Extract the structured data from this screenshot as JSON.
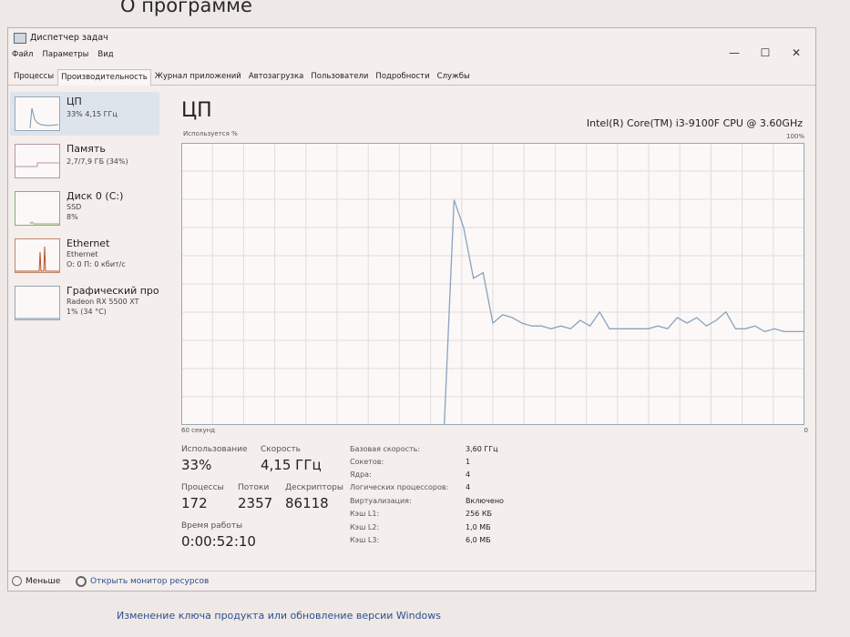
{
  "background": {
    "heading": "О программе",
    "link": "Изменение ключа продукта или обновление версии Windows"
  },
  "window": {
    "title": "Диспетчер задач",
    "controls": {
      "minimize": "—",
      "maximize": "☐",
      "close": "✕"
    }
  },
  "menu": [
    "Файл",
    "Параметры",
    "Вид"
  ],
  "tabs": [
    "Процессы",
    "Производительность",
    "Журнал приложений",
    "Автозагрузка",
    "Пользователи",
    "Подробности",
    "Службы"
  ],
  "active_tab": "Производительность",
  "sidebar": [
    {
      "name": "ЦП",
      "lines": [
        "33% 4,15 ГГц"
      ]
    },
    {
      "name": "Память",
      "lines": [
        "2,7/7,9 ГБ (34%)"
      ]
    },
    {
      "name": "Диск 0 (C:)",
      "lines": [
        "SSD",
        "8%"
      ]
    },
    {
      "name": "Ethernet",
      "lines": [
        "Ethernet",
        "О: 0 П: 0 кбит/с"
      ]
    },
    {
      "name": "Графический про",
      "lines": [
        "Radeon RX 5500 XT",
        "1% (34 °C)"
      ]
    }
  ],
  "main": {
    "title": "ЦП",
    "model": "Intel(R) Core(TM) i3-9100F CPU @ 3.60GHz",
    "graph_label": "Используется %",
    "graph_max": "100%",
    "graph_time": "60 секунд",
    "graph_min": "0"
  },
  "stats": {
    "usage_label": "Использование",
    "usage_value": "33%",
    "speed_label": "Скорость",
    "speed_value": "4,15 ГГц",
    "processes_label": "Процессы",
    "processes_value": "172",
    "threads_label": "Потоки",
    "threads_value": "2357",
    "handles_label": "Дескрипторы",
    "handles_value": "86118",
    "uptime_label": "Время работы",
    "uptime_value": "0:00:52:10"
  },
  "specs": [
    {
      "label": "Базовая скорость:",
      "value": "3,60 ГГц"
    },
    {
      "label": "Сокетов:",
      "value": "1"
    },
    {
      "label": "Ядра:",
      "value": "4"
    },
    {
      "label": "Логических процессоров:",
      "value": "4"
    },
    {
      "label": "Виртуализация:",
      "value": "Включено"
    },
    {
      "label": "Кэш L1:",
      "value": "256 КБ"
    },
    {
      "label": "Кэш L2:",
      "value": "1,0 МБ"
    },
    {
      "label": "Кэш L3:",
      "value": "6,0 МБ"
    }
  ],
  "footer": {
    "less": "Меньше",
    "resmon": "Открыть монитор ресурсов"
  },
  "chart_data": {
    "type": "line",
    "x": [
      0,
      1,
      2,
      3,
      4,
      5,
      6,
      7,
      8,
      9,
      10,
      11,
      12,
      13,
      14,
      15,
      16,
      17,
      18,
      19,
      20,
      21,
      22,
      23,
      24,
      25,
      26,
      27,
      28,
      29,
      30,
      31,
      32,
      33,
      34,
      35,
      36,
      37,
      38,
      39,
      40,
      41,
      42,
      43,
      44,
      45,
      46,
      47,
      48,
      49,
      50,
      51,
      52,
      53,
      54,
      55,
      56,
      57,
      58,
      59,
      60
    ],
    "values": [
      null,
      null,
      null,
      null,
      null,
      null,
      null,
      null,
      null,
      null,
      null,
      null,
      null,
      null,
      null,
      null,
      null,
      null,
      null,
      null,
      null,
      null,
      null,
      null,
      null,
      null,
      null,
      0,
      80,
      70,
      52,
      54,
      36,
      39,
      38,
      36,
      35,
      35,
      34,
      35,
      34,
      37,
      35,
      40,
      34,
      34,
      34,
      34,
      34,
      35,
      34,
      38,
      36,
      38,
      35,
      37,
      40,
      34,
      34,
      35,
      33,
      34,
      33,
      33,
      33
    ],
    "ylim": [
      0,
      100
    ],
    "colors": {
      "line": "#8aa3bf",
      "grid": "#e3dcdc",
      "border": "#9aa7b3"
    }
  }
}
